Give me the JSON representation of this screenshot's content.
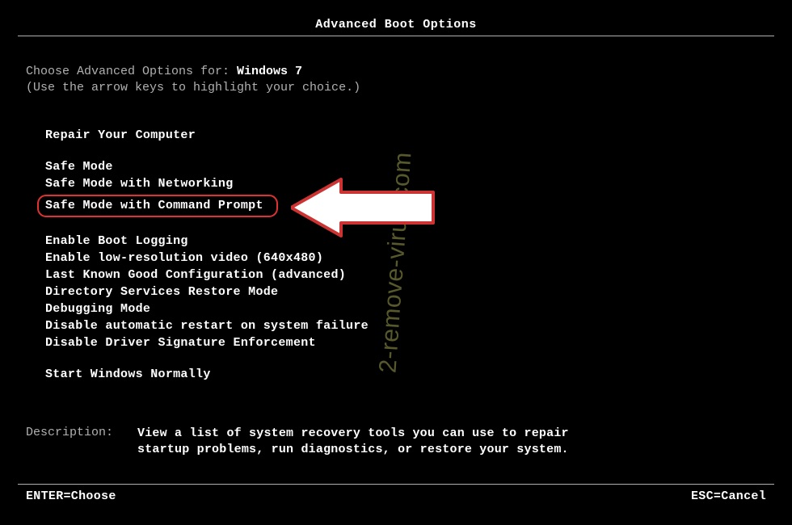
{
  "title": "Advanced Boot Options",
  "intro": {
    "prefix": "Choose Advanced Options for: ",
    "os": "Windows 7",
    "hint": "(Use the arrow keys to highlight your choice.)"
  },
  "groups": {
    "g1": [
      "Repair Your Computer"
    ],
    "g2": [
      "Safe Mode",
      "Safe Mode with Networking",
      "Safe Mode with Command Prompt"
    ],
    "g3": [
      "Enable Boot Logging",
      "Enable low-resolution video (640x480)",
      "Last Known Good Configuration (advanced)",
      "Directory Services Restore Mode",
      "Debugging Mode",
      "Disable automatic restart on system failure",
      "Disable Driver Signature Enforcement"
    ],
    "g4": [
      "Start Windows Normally"
    ]
  },
  "selected_index": {
    "group": "g2",
    "i": 2
  },
  "description": {
    "label": "Description:",
    "text": "View a list of system recovery tools you can use to repair startup problems, run diagnostics, or restore your system."
  },
  "footer": {
    "left": "ENTER=Choose",
    "right": "ESC=Cancel"
  },
  "watermark": "2-remove-virus.com"
}
